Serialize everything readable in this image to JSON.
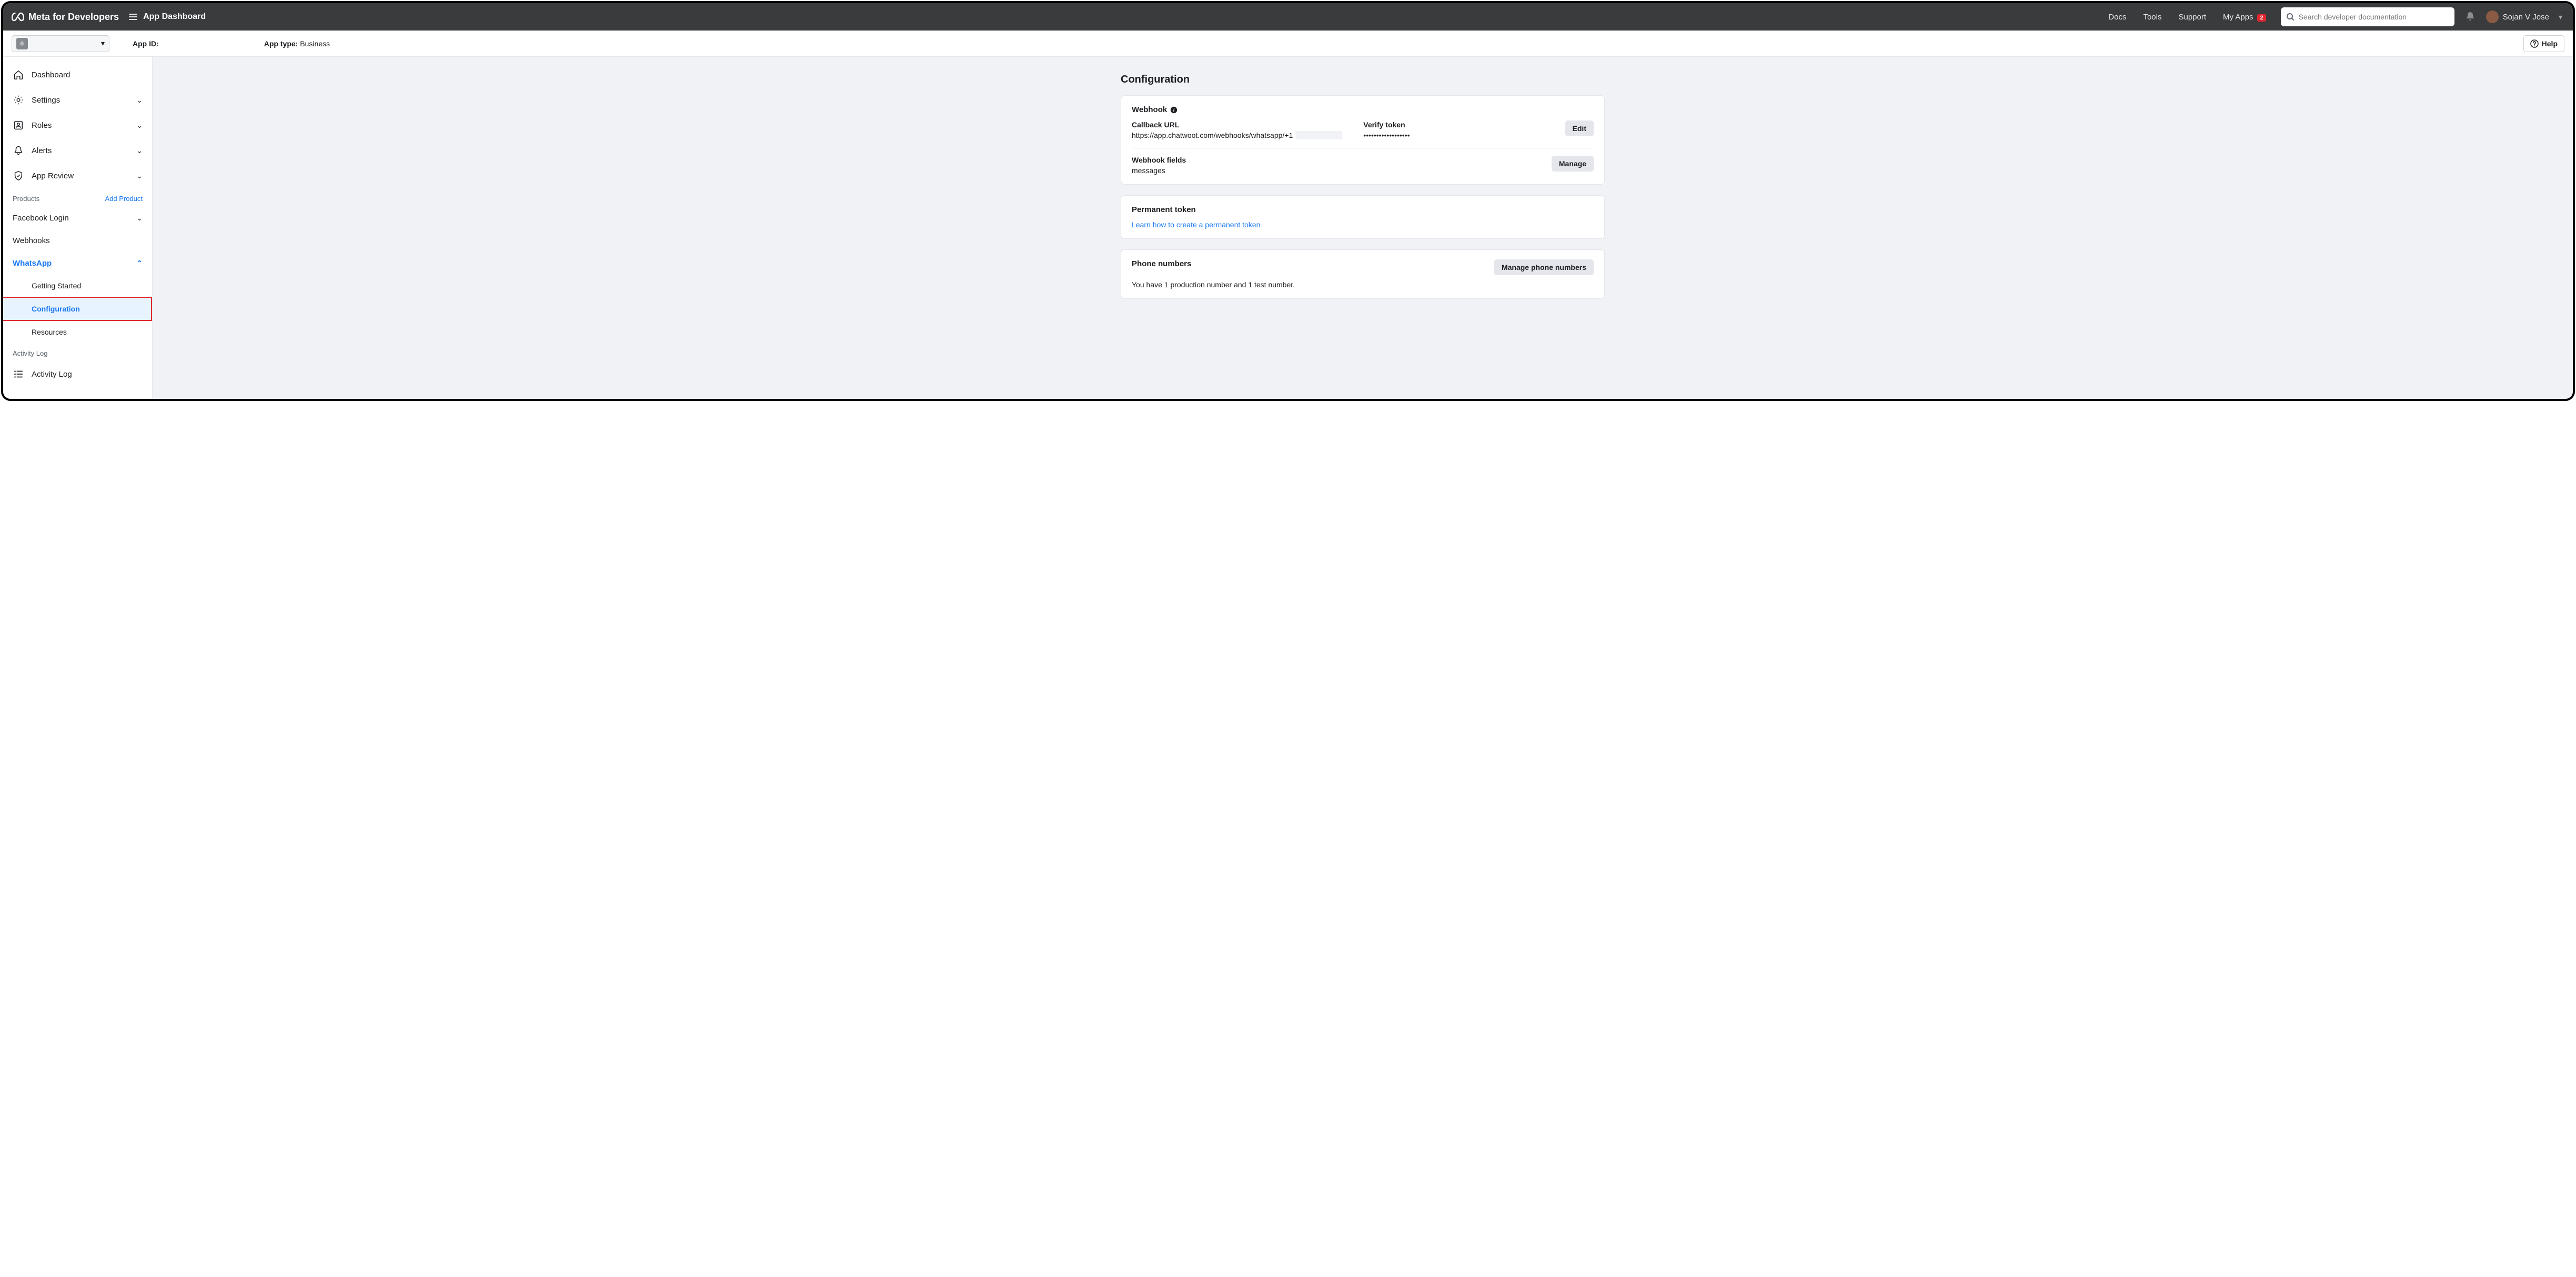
{
  "brand": "Meta for Developers",
  "pageTitle": "App Dashboard",
  "topNav": {
    "docs": "Docs",
    "tools": "Tools",
    "support": "Support",
    "myApps": "My Apps",
    "myAppsBadge": "2"
  },
  "search": {
    "placeholder": "Search developer documentation"
  },
  "user": {
    "name": "Sojan V Jose"
  },
  "subheader": {
    "appIdLabel": "App ID:",
    "appTypeLabel": "App type:",
    "appTypeValue": "Business",
    "helpLabel": "Help"
  },
  "sidebar": {
    "dashboard": "Dashboard",
    "settings": "Settings",
    "roles": "Roles",
    "alerts": "Alerts",
    "appReview": "App Review",
    "productsLabel": "Products",
    "addProduct": "Add Product",
    "facebookLogin": "Facebook Login",
    "webhooks": "Webhooks",
    "whatsapp": "WhatsApp",
    "waGettingStarted": "Getting Started",
    "waConfiguration": "Configuration",
    "waResources": "Resources",
    "activityLogLabel": "Activity Log",
    "activityLog": "Activity Log"
  },
  "content": {
    "title": "Configuration",
    "webhook": {
      "title": "Webhook",
      "callbackUrlLabel": "Callback URL",
      "callbackUrlValue": "https://app.chatwoot.com/webhooks/whatsapp/+1",
      "verifyTokenLabel": "Verify token",
      "verifyTokenMasked": "••••••••••••••••••",
      "editBtn": "Edit",
      "fieldsLabel": "Webhook fields",
      "fieldsValue": "messages",
      "manageBtn": "Manage"
    },
    "permanentToken": {
      "title": "Permanent token",
      "link": "Learn how to create a permanent token"
    },
    "phoneNumbers": {
      "title": "Phone numbers",
      "manageBtn": "Manage phone numbers",
      "text": "You have 1 production number and 1 test number."
    }
  }
}
